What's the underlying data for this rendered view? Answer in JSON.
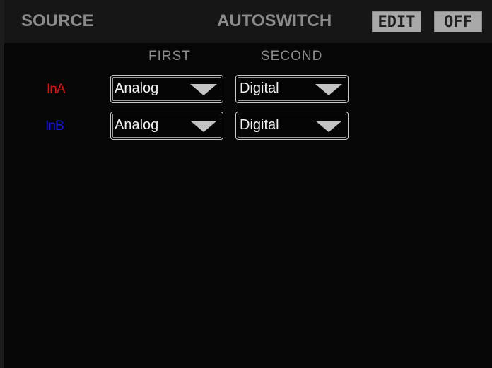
{
  "header": {
    "source_title": "SOURCE",
    "autoswitch_title": "AUTOSWITCH",
    "edit_label": "EDIT",
    "off_label": "OFF"
  },
  "columns": {
    "first": "FIRST",
    "second": "SECOND"
  },
  "rows": [
    {
      "label": "InA",
      "color": "#e01414",
      "first": "Analog",
      "second": "Digital"
    },
    {
      "label": "InB",
      "color": "#1a1ad8",
      "first": "Analog",
      "second": "Digital"
    }
  ],
  "icons": {
    "dropdown": "chevron-down-icon"
  }
}
